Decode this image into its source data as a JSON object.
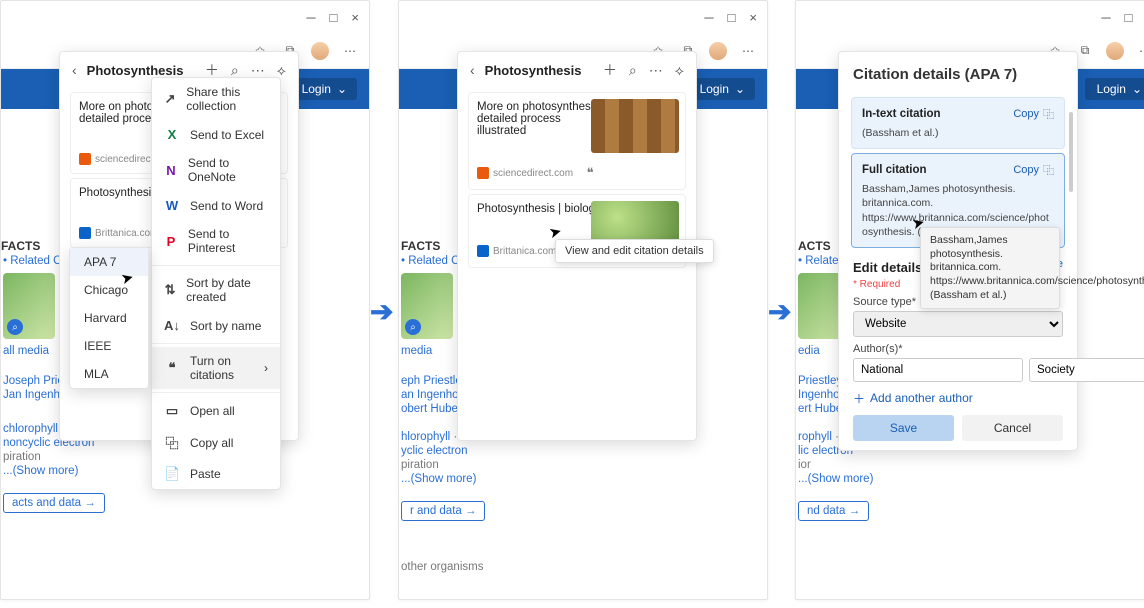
{
  "titlebar": {
    "min": "─",
    "max": "□",
    "close": "×"
  },
  "toolbar": {
    "fav": "✩",
    "collections": "⧉",
    "more": "⋯"
  },
  "navbar": {
    "login": "Login",
    "chev": "⌄"
  },
  "collection": {
    "back": "‹",
    "title": "Photosynthesis",
    "add": "＋",
    "search": "⌕",
    "more": "⋯",
    "pin": "⟡",
    "cards": [
      {
        "title_full": "More on photosynthesis - detailed process illustrated",
        "title_trunc": "More on photosynthesis - detailed process illus",
        "source": "sciencedirect.com"
      },
      {
        "title_full": "Photosynthesis | biology",
        "title_trunc": "Photosynthesis | biol",
        "source": "Brittanica.com"
      }
    ]
  },
  "menu": {
    "share": "Share this collection",
    "excel": "Send to Excel",
    "onenote": "Send to OneNote",
    "word": "Send to Word",
    "pinterest": "Send to Pinterest",
    "sort_date": "Sort by date created",
    "sort_name": "Sort by name",
    "citations": "Turn on citations",
    "open_all": "Open all",
    "copy_all": "Copy all",
    "paste": "Paste"
  },
  "citation_styles": [
    "APA 7",
    "Chicago",
    "Harvard",
    "IEEE",
    "MLA"
  ],
  "glyph": {
    "share": "↗",
    "sort": "⇅",
    "az": "A↓",
    "quote": "❝",
    "chev_right": "›",
    "open": "▭",
    "copy": "⿻",
    "paste": "📋",
    "plus": "＋",
    "copyico": "⿻"
  },
  "tooltip_edit": "View and edit citation details",
  "citation_panel": {
    "title": "Citation details (APA 7)",
    "intext": {
      "label": "In-text citation",
      "copy": "Copy",
      "body": "(Bassham et al.)"
    },
    "full": {
      "label": "Full citation",
      "copy": "Copy",
      "body": "Bassham,James photosynthesis. britannica.com. https://www.britannica.com/science/photosynthesis. (Bassham et al.)"
    },
    "hover_tip": "Bassham,James photosynthesis. britannica.com. https://www.britannica.com/science/photosynthesis. (Bassham et al.)",
    "edit": {
      "heading": "Edit details",
      "source_link": "Source",
      "required": "* Required",
      "source_type_label": "Source type*",
      "source_type_value": "Website",
      "authors_label": "Author(s)*",
      "first": "National",
      "last": "Society",
      "add_author": "Add another author",
      "save": "Save",
      "cancel": "Cancel"
    }
  },
  "bg": {
    "facts": "FACTS",
    "related": "Related Co",
    "media": "media",
    "all_media": "all media",
    "priestley": "Joseph Priestley",
    "priestley_s": "eph Priestley",
    "priestley_xs": "Priestley",
    "ingen": "Jan Ingenhousz",
    "ingen_s": "an Ingenhousz",
    "ingen_xs": "Ingenhousz",
    "huber": "Robert Huber",
    "huber_s": "obert Huber",
    "huber_xs": "ert Huber",
    "chlor": "chlorophyll",
    "chlor_s": "hlorophyll",
    "chlor_xs": "rophyll",
    "elec": "noncyclic electron",
    "elec_s": "yclic electron",
    "elec_xs": "lic electron",
    "piration": "piration",
    "ior": "ior",
    "show_more": "...(Show more)",
    "cta": "acts and data →",
    "cta_s": "r and data →",
    "cta_xs": "nd data →",
    "organisms": "other organisms"
  }
}
